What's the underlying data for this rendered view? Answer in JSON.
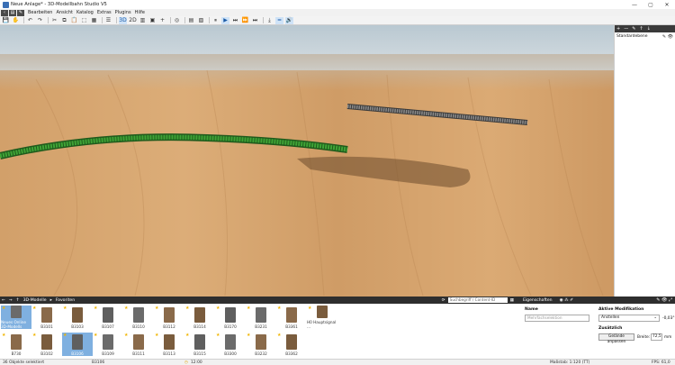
{
  "window": {
    "title": "Neue Anlage* - 3D-Modellbahn Studio V5",
    "controls": [
      "—",
      "▢",
      "✕"
    ]
  },
  "menu": {
    "items": [
      "Bearbeiten",
      "Ansicht",
      "Katalog",
      "Extras",
      "Plugins",
      "Hilfe"
    ]
  },
  "toolbar": {
    "tools": [
      "save-icon",
      "hand-icon",
      "undo-icon",
      "redo-icon",
      "cut-icon",
      "copy-icon",
      "paste-icon",
      "select-icon",
      "grid-icon",
      "list-icon",
      "3d-view",
      "2d-view",
      "table-icon",
      "camera-icon",
      "add-icon",
      "target-icon",
      "doc-icon",
      "layout-icon",
      "pause-icon",
      "play-icon",
      "step-icon",
      "fast-icon",
      "end-icon",
      "download-icon",
      "track-icon",
      "sound-icon"
    ]
  },
  "layers": {
    "header": [
      "+",
      "—",
      "✎",
      "↑",
      "↓"
    ],
    "row": "Standardebene"
  },
  "catalog": {
    "nav": [
      "←",
      "→",
      "↑"
    ],
    "breadcrumb": [
      "3D-Modelle",
      "▸",
      "Favoriten"
    ],
    "search_placeholder": "Suchbegriff / Content-ID",
    "items_row1": [
      "Neues Online 3D-Modells",
      "B3101",
      "B3103",
      "B3107",
      "B3110",
      "B3112",
      "B3114",
      "B3170",
      "B3231",
      "B3361",
      "H0 Hauptsignal ..."
    ],
    "items_row2": [
      "B730",
      "B3102",
      "B3106",
      "B3109",
      "B3111",
      "B3113",
      "B3115",
      "B3300",
      "B3232",
      "B3362"
    ]
  },
  "properties": {
    "title": "Eigenschaften",
    "name_label": "Name",
    "name_placeholder": "Mehrfachselektion",
    "mod_label": "Aktive Modifikation",
    "mod_value": "Anstellen",
    "mod_number": "-0,03°",
    "extra_label": "Zusätzlich",
    "adjust_button": "Gelände anpassen",
    "width_label": "Breite:",
    "width_value": "72,5",
    "width_unit": "mm"
  },
  "status": {
    "selected": "36 Objekte selektiert",
    "model": "B3106",
    "time": "12:00",
    "scale": "Maßstab: 1:120 (TT)",
    "fps": "FPS: 61,0"
  },
  "colors": {
    "accent": "#1a5aa6",
    "track_green": "#2f8a2a",
    "wood": "#d4a36d"
  }
}
